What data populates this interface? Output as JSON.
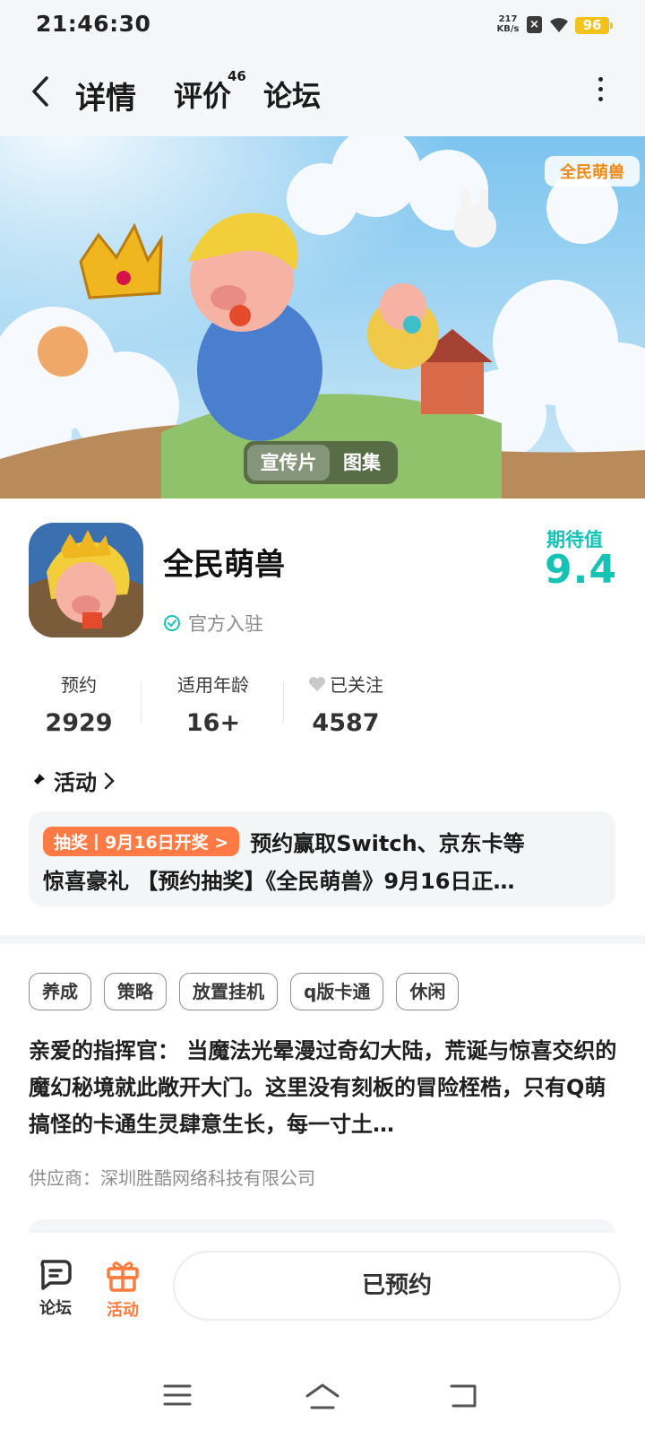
{
  "status_bar": {
    "time": "21:46:30",
    "net_speed": "217",
    "net_unit": "KB/s",
    "sim_icon": "x-sim-icon",
    "wifi_icon": "wifi-icon",
    "battery": "96"
  },
  "header": {
    "back_icon": "chevron-left-icon",
    "tabs": [
      {
        "label": "详情",
        "active": true
      },
      {
        "label": "评价",
        "count": "46"
      },
      {
        "label": "论坛"
      }
    ],
    "more_icon": "more-vertical-icon"
  },
  "banner": {
    "logo_text": "全民萌兽",
    "video_label": "宣传片",
    "gallery_label": "图集"
  },
  "game": {
    "name": "全民萌兽",
    "official_label": "官方入驻",
    "expect_label": "期待值",
    "expect_score": "9.4",
    "accent_color": "#16c2b4"
  },
  "stats": [
    {
      "label": "预约",
      "value": "2929"
    },
    {
      "label": "适用年龄",
      "value": "16+"
    },
    {
      "label": "已关注",
      "value": "4587",
      "icon": "heart-icon"
    }
  ],
  "activity": {
    "title": "活动",
    "badge": "抽奖丨9月16日开奖 >",
    "badge_color": "#ff7a45",
    "line1": "预约赢取Switch、京东卡等",
    "line2": "惊喜豪礼 【预约抽奖】《全民萌兽》9月16日正…"
  },
  "tags": [
    "养成",
    "策略",
    "放置挂机",
    "q版卡通",
    "休闲"
  ],
  "description": "亲爱的指挥官： 当魔法光晕漫过奇幻大陆，荒诞与惊喜交织的魔幻秘境就此敞开大门。这里没有刻板的冒险桎梏，只有Q萌搞怪的卡通生灵肆意生长，每一寸土…",
  "supplier": "供应商：深圳胜酷网络科技有限公司",
  "bottom_bar": {
    "forum_label": "论坛",
    "activity_label": "活动",
    "reserve_label": "已预约"
  },
  "system_nav": [
    "menu-icon",
    "home-icon",
    "back-icon"
  ]
}
